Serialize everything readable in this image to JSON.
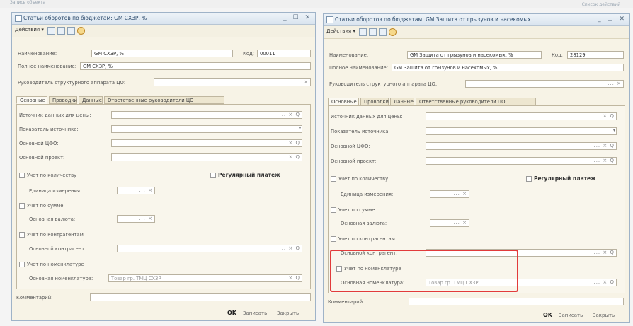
{
  "desktop": {
    "top_left": "Запись объекта",
    "top_right": "Список действий"
  },
  "left": {
    "title": "Статьи оборотов по бюджетам: GM СХЗР, %",
    "title_buttons": "_ ☐ ✕",
    "actions": "Действия ▾",
    "name_label": "Наименование:",
    "name_value": "GM СХЗР, %",
    "code_label": "Код:",
    "code_value": "00011",
    "fullname_label": "Полное наименование:",
    "fullname_value": "GM СХЗР, %",
    "head_label": "Руководитель структурного аппарата ЦО:",
    "tabs": [
      "Основные",
      "Проводки",
      "Данные",
      "Ответственные руководители ЦО"
    ],
    "src_label": "Источник данных для цены:",
    "indicator_label": "Показатель источника:",
    "cfo_label": "Основной ЦФО:",
    "project_label": "Основной проект:",
    "qty_label": "Учет по количеству",
    "regular_label": "Регулярный платеж",
    "unit_label": "Единица измерения:",
    "sum_label": "Учет по сумме",
    "currency_label": "Основная валюта:",
    "contr_label": "Учет по контрагентам",
    "main_contr_label": "Основной контрагент:",
    "nom_label": "Учет по номенклатуре",
    "main_nom_label": "Основная номенклатура:",
    "main_nom_value": "Товар гр. ТМЦ СХЗР",
    "comment_label": "Комментарий:",
    "ok": "OK",
    "save": "Записать",
    "close": "Закрыть"
  },
  "right": {
    "title": "Статьи оборотов по бюджетам: GM Защита от грызунов и насекомых",
    "title_buttons": "_ ☐ ✕",
    "actions": "Действия ▾",
    "name_label": "Наименование:",
    "name_value": "GM Защита от грызунов и насекомых, %",
    "code_label": "Код:",
    "code_value": "28129",
    "fullname_label": "Полное наименование:",
    "fullname_value": "GM Защита от грызунов и насекомых, %",
    "head_label": "Руководитель структурного аппарата ЦО:",
    "tabs": [
      "Основные",
      "Проводки",
      "Данные",
      "Ответственные руководители ЦО"
    ],
    "src_label": "Источник данных для цены:",
    "indicator_label": "Показатель источника:",
    "cfo_label": "Основной ЦФО:",
    "project_label": "Основной проект:",
    "qty_label": "Учет по количеству",
    "regular_label": "Регулярный платеж",
    "unit_label": "Единица измерения:",
    "sum_label": "Учет по сумме",
    "currency_label": "Основная валюта:",
    "contr_label": "Учет по контрагентам",
    "main_contr_label": "Основной контрагент:",
    "nom_label": "Учет по номенклатуре",
    "main_nom_label": "Основная номенклатура:",
    "main_nom_value": "Товар гр. ТМЦ СХЗР",
    "comment_label": "Комментарий:",
    "ok": "OK",
    "save": "Записать",
    "close": "Закрыть"
  },
  "field_buttons": "... × Q",
  "field_buttons_short": "... ×",
  "dropdown_arrow": "▾",
  "colors": {
    "highlight": "#e23b3b",
    "window_bg": "#f7f3e6",
    "titlebar": "#d9e4ef"
  },
  "icons": [
    "window-icon",
    "edit-icon",
    "save-icon",
    "copy-icon",
    "help-icon",
    "gear-icon"
  ]
}
